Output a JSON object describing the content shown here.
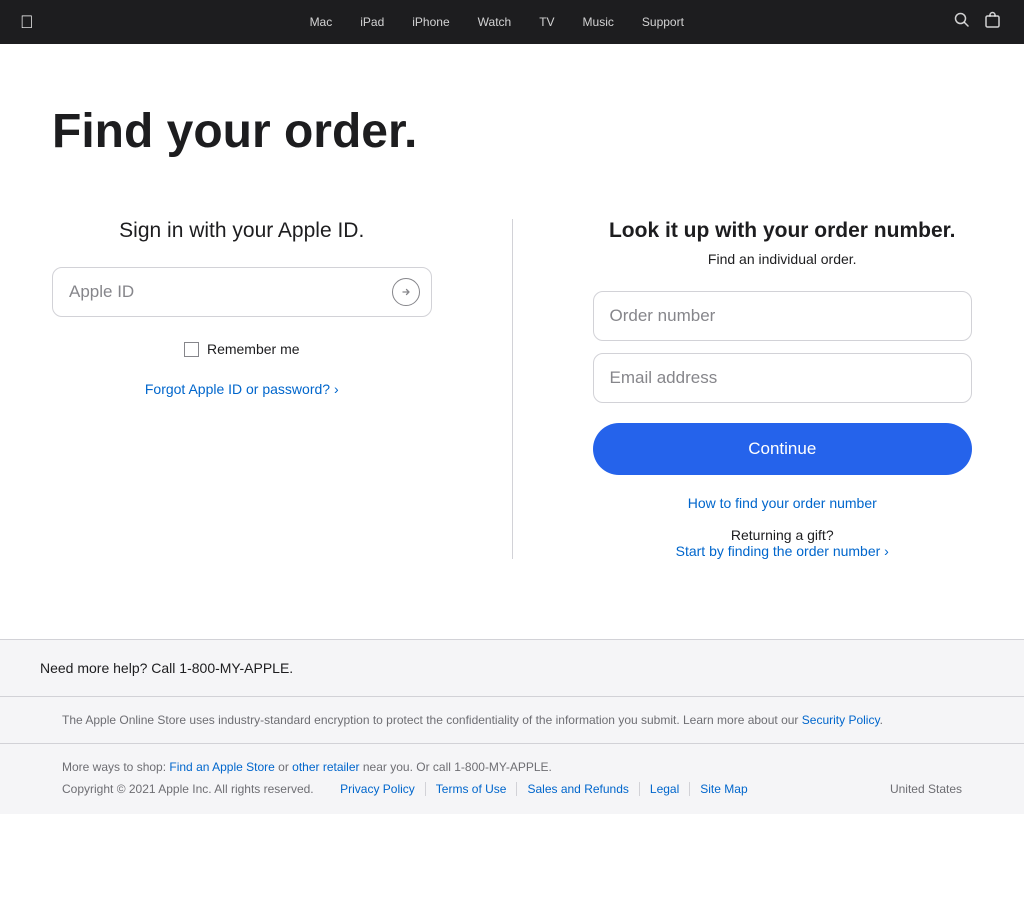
{
  "nav": {
    "apple_label": "",
    "links": [
      {
        "label": "Mac",
        "id": "mac"
      },
      {
        "label": "iPad",
        "id": "ipad"
      },
      {
        "label": "iPhone",
        "id": "iphone"
      },
      {
        "label": "Watch",
        "id": "watch"
      },
      {
        "label": "TV",
        "id": "tv"
      },
      {
        "label": "Music",
        "id": "music"
      },
      {
        "label": "Support",
        "id": "support"
      }
    ],
    "search_icon": "🔍",
    "bag_icon": "🛍"
  },
  "page": {
    "title": "Find your order.",
    "left": {
      "section_title": "Sign in with your Apple ID.",
      "apple_id_placeholder": "Apple ID",
      "remember_label": "Remember me",
      "forgot_link": "Forgot Apple ID or password? ›"
    },
    "right": {
      "title": "Look it up with your order number.",
      "subtitle": "Find an individual order.",
      "order_number_placeholder": "Order number",
      "email_placeholder": "Email address",
      "continue_label": "Continue",
      "how_to_link": "How to find your order number",
      "returning_gift_text": "Returning a gift?",
      "start_finding_link": "Start by finding the order number ›"
    }
  },
  "help": {
    "text": "Need more help? Call 1-800-MY-APPLE."
  },
  "footer": {
    "security_text": "The Apple Online Store uses industry-standard encryption to protect the confidentiality of the information you submit. Learn more about our",
    "security_link_label": "Security Policy",
    "shop_text": "More ways to shop:",
    "find_store_label": "Find an Apple Store",
    "or_text": "or",
    "other_retailer_label": "other retailer",
    "near_text": "near you. Or call 1-800-MY-APPLE.",
    "copyright": "Copyright © 2021 Apple Inc. All rights reserved.",
    "nav_links": [
      {
        "label": "Privacy Policy",
        "id": "privacy"
      },
      {
        "label": "Terms of Use",
        "id": "terms"
      },
      {
        "label": "Sales and Refunds",
        "id": "sales"
      },
      {
        "label": "Legal",
        "id": "legal"
      },
      {
        "label": "Site Map",
        "id": "sitemap"
      }
    ],
    "region": "United States"
  }
}
